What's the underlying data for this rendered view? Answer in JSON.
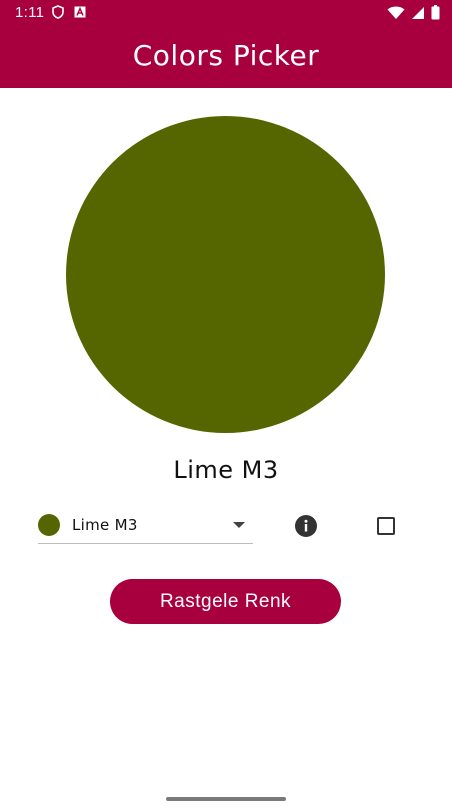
{
  "status_bar": {
    "time": "1:11"
  },
  "app_bar": {
    "title": "Colors Picker"
  },
  "color_preview": {
    "name": "Lime M3",
    "color": "#556600"
  },
  "dropdown": {
    "selected_label": "Lime M3",
    "selected_color": "#556600"
  },
  "random_button": {
    "label": "Rastgele Renk"
  },
  "colors": {
    "brand": "#a8003f",
    "background": "#ffffff"
  }
}
